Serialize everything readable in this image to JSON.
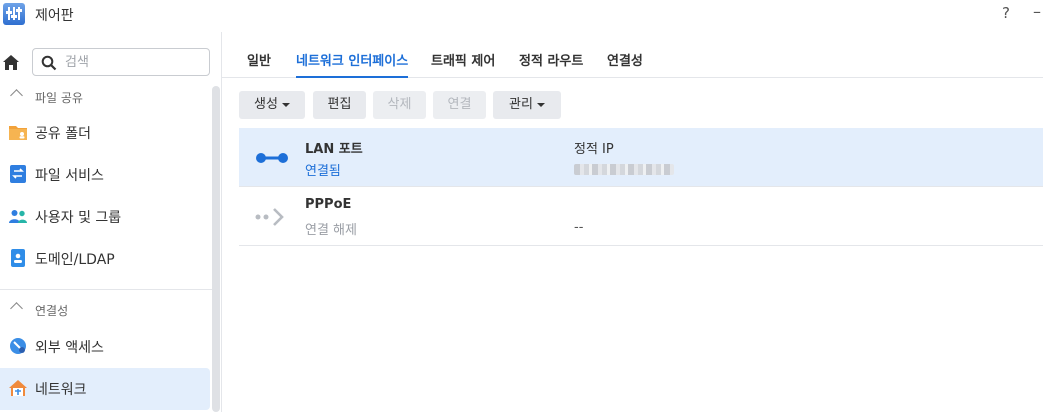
{
  "window": {
    "title": "제어판",
    "help": "?",
    "minimize": "–"
  },
  "sidebar": {
    "search_placeholder": "검색",
    "sections": [
      {
        "label": "파일 공유",
        "items": [
          "공유 폴더",
          "파일 서비스",
          "사용자 및 그룹",
          "도메인/LDAP"
        ]
      },
      {
        "label": "연결성",
        "items": [
          "외부 액세스",
          "네트워크"
        ]
      }
    ],
    "active_item": "네트워크"
  },
  "tabs": [
    "일반",
    "네트워크 인터페이스",
    "트래픽 제어",
    "정적 라우트",
    "연결성"
  ],
  "active_tab": "네트워크 인터페이스",
  "toolbar": {
    "create": "생성",
    "edit": "편집",
    "delete": "삭제",
    "connect": "연결",
    "manage": "관리"
  },
  "interfaces": [
    {
      "name": "LAN 포트",
      "status": "연결됨",
      "ip_type": "정적 IP",
      "ip": "",
      "status_color": "#1d6fd8",
      "selected": true
    },
    {
      "name": "PPPoE",
      "status": "연결 해제",
      "ip_type": "",
      "ip": "--",
      "status_color": "#9a9ea5",
      "selected": false
    }
  ],
  "colors": {
    "accent": "#1d6fd8",
    "selected_bg": "#e3eefc"
  }
}
